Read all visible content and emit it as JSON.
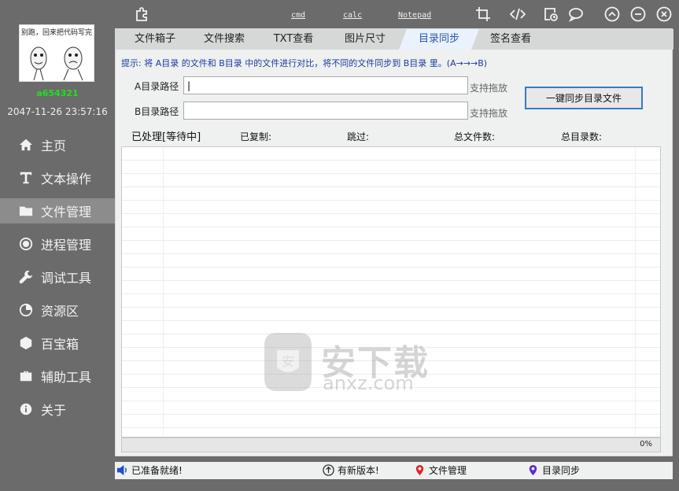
{
  "sidebar": {
    "avatar_caption": "别跑，回来把代码写完",
    "username": "a654321",
    "datetime": "2047-11-26 23:57:16",
    "items": [
      {
        "label": "主页",
        "icon": "home-icon"
      },
      {
        "label": "文本操作",
        "icon": "text-icon"
      },
      {
        "label": "文件管理",
        "icon": "folder-icon"
      },
      {
        "label": "进程管理",
        "icon": "radio-icon"
      },
      {
        "label": "调试工具",
        "icon": "wrench-icon"
      },
      {
        "label": "资源区",
        "icon": "pie-icon"
      },
      {
        "label": "百宝箱",
        "icon": "hexagon-icon"
      },
      {
        "label": "辅助工具",
        "icon": "briefcase-icon"
      },
      {
        "label": "关于",
        "icon": "info-icon"
      }
    ],
    "active_index": 2
  },
  "topbar": {
    "links": [
      "cmd",
      "calc",
      "Notepad"
    ],
    "icons": [
      "plugin-icon",
      "crop-icon",
      "code-icon",
      "note-clock-icon",
      "chat-icon",
      "collapse-icon",
      "minimize-icon",
      "close-icon"
    ]
  },
  "tabs": [
    "文件箱子",
    "文件搜索",
    "TXT查看",
    "图片尺寸",
    "目录同步",
    "签名查看"
  ],
  "active_tab": 4,
  "sync": {
    "tip": "提示: 将 A目录 的文件和 B目录 中的文件进行对比，将不同的文件同步到 B目录 里。(A→→→B)",
    "a_label": "A目录路径",
    "b_label": "B目录路径",
    "a_value": "|",
    "b_value": "",
    "a_hint": "支持拖放",
    "b_hint": "支持拖放",
    "button": "一键同步目录文件"
  },
  "stats": {
    "processed": "已处理[等待中]",
    "copied": "已复制:",
    "skipped": "跳过:",
    "total_files": "总文件数:",
    "total_dirs": "总目录数:"
  },
  "progress": {
    "percent_text": "0%",
    "value": 0
  },
  "watermark": {
    "text": "安下载",
    "sub": "anxz.com"
  },
  "status": {
    "ready": "已准备就绪!",
    "new_version": "有新版本!",
    "location1": "文件管理",
    "location2": "目录同步"
  },
  "colors": {
    "sidebar_bg": "#6b6b6b",
    "active_nav": "#8c8c8c",
    "username": "#20e020",
    "tip_text": "#1a3aa0",
    "button_border": "#3a78c8"
  }
}
